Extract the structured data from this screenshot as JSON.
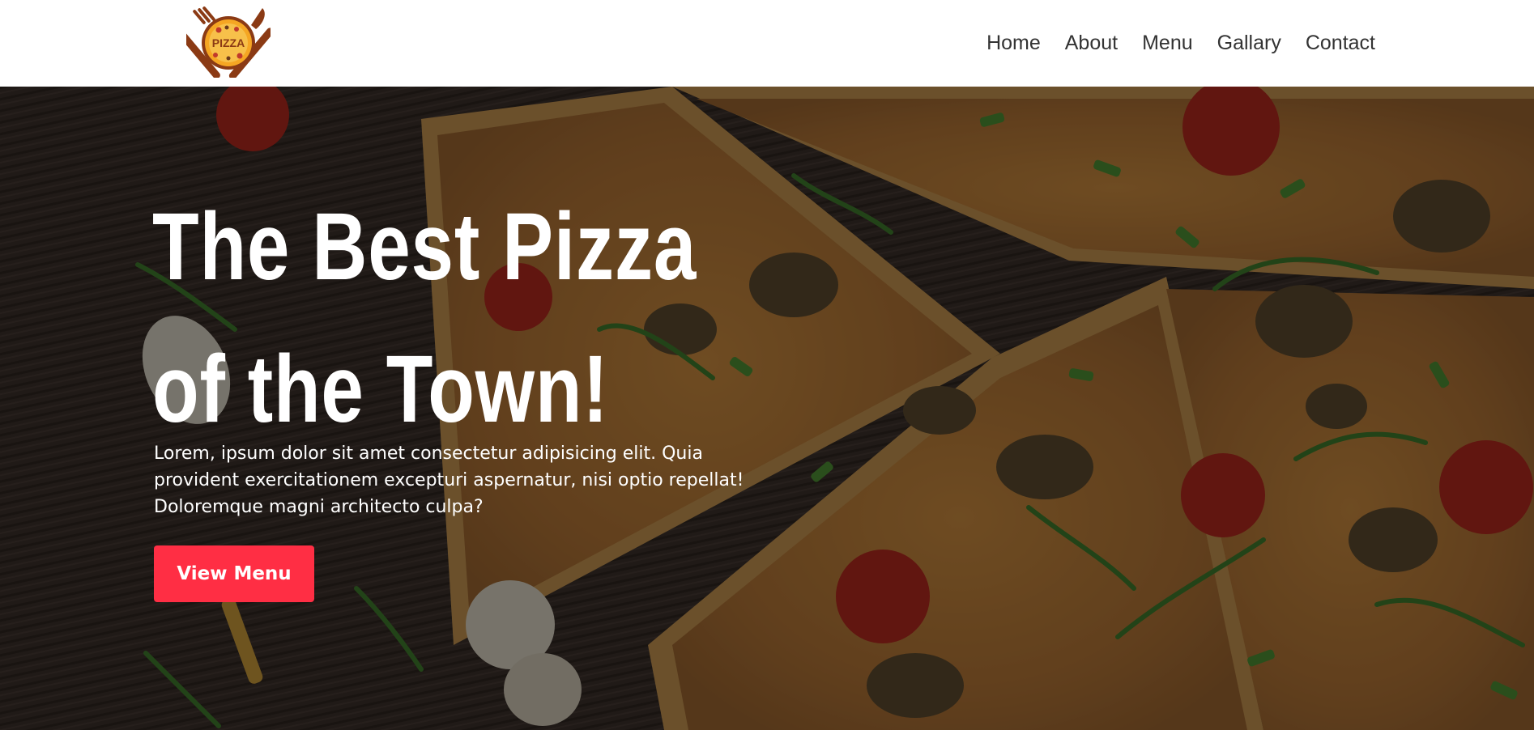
{
  "brand": {
    "logo_text": "PIZZA"
  },
  "nav": {
    "items": [
      {
        "label": "Home"
      },
      {
        "label": "About"
      },
      {
        "label": "Menu"
      },
      {
        "label": "Gallary"
      },
      {
        "label": "Contact"
      }
    ]
  },
  "hero": {
    "title_line1": "The Best Pizza",
    "title_line2": "of the Town!",
    "description": "Lorem, ipsum dolor sit amet consectetur adipisicing elit. Quia provident exercitationem excepturi aspernatur, nisi optio repellat! Doloremque magni architecto culpa?",
    "button_label": "View Menu"
  },
  "colors": {
    "accent": "#ff2e44",
    "header_bg": "#ffffff",
    "nav_text": "#333333",
    "logo_orange": "#f5a623",
    "logo_brown": "#8b3a14"
  }
}
